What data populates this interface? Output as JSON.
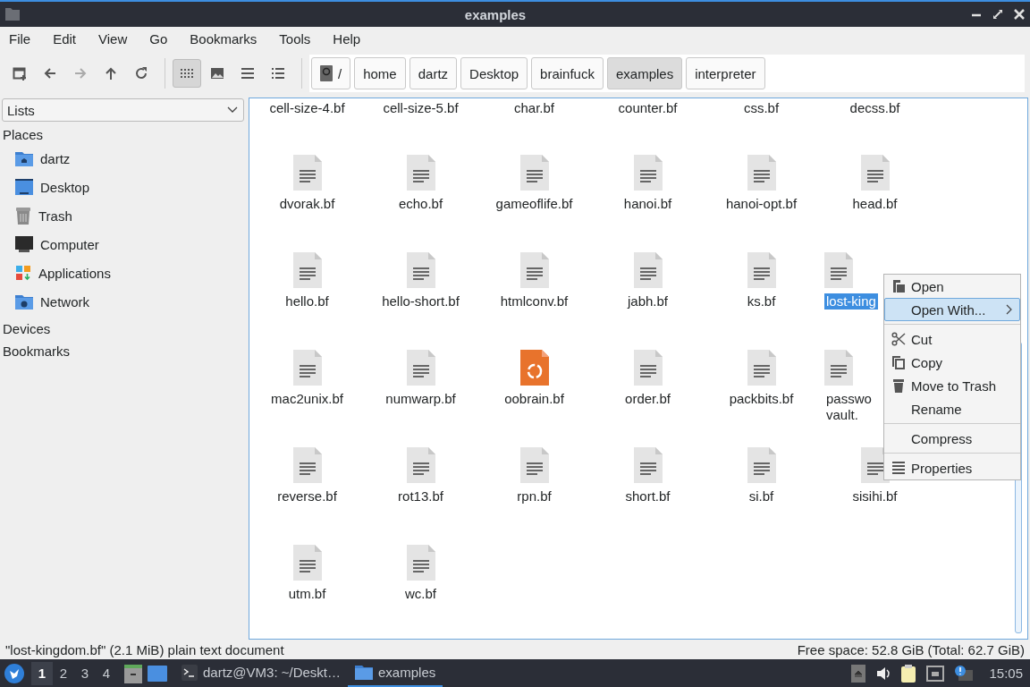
{
  "window": {
    "title": "examples"
  },
  "menubar": [
    "File",
    "Edit",
    "View",
    "Go",
    "Bookmarks",
    "Tools",
    "Help"
  ],
  "toolbar": {
    "nav": [
      {
        "kind": "new-tab",
        "disabled": false
      },
      {
        "kind": "back",
        "disabled": false
      },
      {
        "kind": "forward",
        "disabled": true
      },
      {
        "kind": "up",
        "disabled": false
      },
      {
        "kind": "reload",
        "disabled": false
      }
    ],
    "views": [
      {
        "kind": "icons",
        "selected": true
      },
      {
        "kind": "thumbnails",
        "selected": false
      },
      {
        "kind": "compact",
        "selected": false
      },
      {
        "kind": "details",
        "selected": false
      }
    ]
  },
  "path": [
    {
      "label": "/",
      "kind": "root",
      "selected": false
    },
    {
      "label": "home",
      "selected": false
    },
    {
      "label": "dartz",
      "selected": false
    },
    {
      "label": "Desktop",
      "selected": false
    },
    {
      "label": "brainfuck",
      "selected": false
    },
    {
      "label": "examples",
      "selected": true
    },
    {
      "label": "interpreter",
      "selected": false
    }
  ],
  "sidebar": {
    "mode": "Lists",
    "sections": [
      {
        "title": "Places",
        "items": [
          {
            "label": "dartz",
            "kind": "home"
          },
          {
            "label": "Desktop",
            "kind": "desktop"
          },
          {
            "label": "Trash",
            "kind": "trash"
          },
          {
            "label": "Computer",
            "kind": "computer"
          },
          {
            "label": "Applications",
            "kind": "applications"
          },
          {
            "label": "Network",
            "kind": "network"
          }
        ]
      },
      {
        "title": "Devices"
      },
      {
        "title": "Bookmarks"
      }
    ]
  },
  "files": [
    {
      "name": "cell-size-4.bf",
      "selected": false
    },
    {
      "name": "cell-size-5.bf",
      "selected": false
    },
    {
      "name": "char.bf",
      "selected": false
    },
    {
      "name": "counter.bf",
      "selected": false
    },
    {
      "name": "css.bf",
      "selected": false
    },
    {
      "name": "decss.bf",
      "selected": false
    },
    {
      "name": "dvorak.bf",
      "kind": "text",
      "selected": false
    },
    {
      "name": "echo.bf",
      "kind": "text",
      "selected": false
    },
    {
      "name": "gameoflife.bf",
      "kind": "text",
      "selected": false
    },
    {
      "name": "hanoi.bf",
      "kind": "text",
      "selected": false
    },
    {
      "name": "hanoi-opt.bf",
      "kind": "text",
      "selected": false
    },
    {
      "name": "head.bf",
      "kind": "text",
      "selected": false
    },
    {
      "name": "hello.bf",
      "kind": "text",
      "selected": false
    },
    {
      "name": "hello-short.bf",
      "kind": "text",
      "selected": false
    },
    {
      "name": "htmlconv.bf",
      "kind": "text",
      "selected": false
    },
    {
      "name": "jabh.bf",
      "kind": "text",
      "selected": false
    },
    {
      "name": "ks.bf",
      "kind": "text",
      "selected": false
    },
    {
      "name": "lost-king",
      "kind": "text",
      "selected": true
    },
    {
      "name": "mac2unix.bf",
      "kind": "text",
      "selected": false
    },
    {
      "name": "numwarp.bf",
      "kind": "text",
      "selected": false
    },
    {
      "name": "oobrain.bf",
      "kind": "package",
      "selected": false
    },
    {
      "name": "order.bf",
      "kind": "text",
      "selected": false
    },
    {
      "name": "packbits.bf",
      "kind": "text",
      "selected": false
    },
    {
      "name": "passwo\nvault.",
      "kind": "text",
      "selected": false
    },
    {
      "name": "reverse.bf",
      "kind": "text",
      "selected": false
    },
    {
      "name": "rot13.bf",
      "kind": "text",
      "selected": false
    },
    {
      "name": "rpn.bf",
      "kind": "text",
      "selected": false
    },
    {
      "name": "short.bf",
      "kind": "text",
      "selected": false
    },
    {
      "name": "si.bf",
      "kind": "text",
      "selected": false
    },
    {
      "name": "sisihi.bf",
      "kind": "text",
      "selected": false
    },
    {
      "name": "utm.bf",
      "kind": "text",
      "selected": false
    },
    {
      "name": "wc.bf",
      "kind": "text",
      "selected": false
    }
  ],
  "context_menu": {
    "groups": [
      [
        {
          "label": "Open",
          "kind": "open",
          "selected": false
        },
        {
          "label": "Open With...",
          "selected": true,
          "submenu": true
        }
      ],
      [
        {
          "label": "Cut",
          "kind": "cut",
          "selected": false
        },
        {
          "label": "Copy",
          "kind": "copy",
          "selected": false
        },
        {
          "label": "Move to Trash",
          "kind": "trash",
          "selected": false
        },
        {
          "label": "Rename",
          "selected": false
        }
      ],
      [
        {
          "label": "Compress",
          "selected": false
        }
      ],
      [
        {
          "label": "Properties",
          "kind": "properties",
          "selected": false
        }
      ]
    ]
  },
  "status_bar": {
    "left": "\"lost-kingdom.bf\" (2.1 MiB) plain text document",
    "right": "Free space: 52.8 GiB (Total: 62.7 GiB)"
  },
  "taskbar": {
    "workspaces": [
      {
        "label": "1",
        "selected": true
      },
      {
        "label": "2",
        "selected": false
      },
      {
        "label": "3",
        "selected": false
      },
      {
        "label": "4",
        "selected": false
      }
    ],
    "tasks": [
      {
        "label": "dartz@VM3: ~/Deskt…",
        "kind": "terminal",
        "selected": false
      },
      {
        "label": "examples",
        "kind": "folder",
        "selected": true
      }
    ],
    "clock": "15:05"
  }
}
